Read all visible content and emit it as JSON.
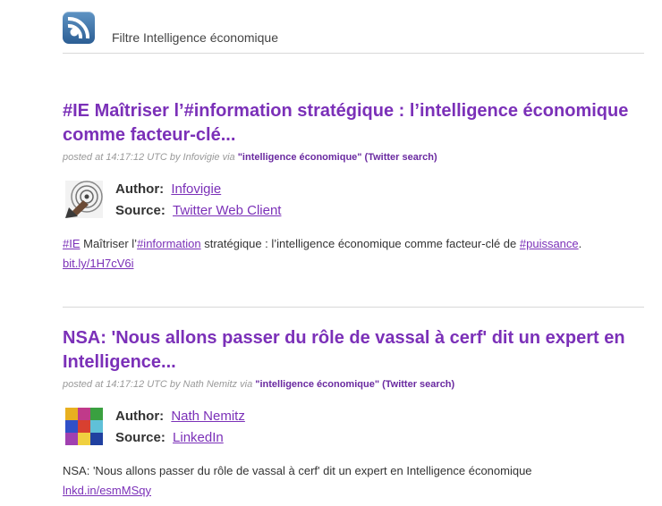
{
  "header": {
    "feed_icon": "rss-icon",
    "feed_title": "Filtre Intelligence économique"
  },
  "entries": [
    {
      "title": "#IE Maîtriser l’#information stratégique : l’intelligence économique comme facteur-clé...",
      "meta": {
        "posted_at": "posted at 14:17:12 UTC by",
        "author": "Infovigie",
        "via_label": "via",
        "via_link": "\"intelligence économique\" (Twitter search)"
      },
      "author_label": "Author:",
      "author_name": "Infovigie",
      "source_label": "Source:",
      "source_name": "Twitter Web Client",
      "avatar_icon": "target-avatar",
      "content": {
        "hashtag1": "#IE",
        "text1": " Maîtriser l’",
        "hashtag2": "#information",
        "text2": " stratégique : l’intelligence économique comme facteur-clé de ",
        "hashtag3": "#puissance",
        "text3": ".",
        "link": "bit.ly/1H7cV6i"
      }
    },
    {
      "title": "NSA: 'Nous allons passer du rôle de vassal à cerf' dit un expert en Intelligence...",
      "meta": {
        "posted_at": "posted at 14:17:12 UTC by",
        "author": "Nath Nemitz",
        "via_label": "via",
        "via_link": "\"intelligence économique\" (Twitter search)"
      },
      "author_label": "Author:",
      "author_name": "Nath Nemitz",
      "source_label": "Source:",
      "source_name": "LinkedIn",
      "avatar_icon": "pop-art-mosaic-avatar",
      "content": {
        "text1": "NSA: 'Nous allons passer du rôle de vassal à cerf' dit un expert en Intelligence économique",
        "link": "lnkd.in/esmMSqy"
      }
    }
  ],
  "colors": {
    "link_purple": "#7b30b8",
    "meta_gray": "#999999",
    "divider": "#d8d8d8",
    "rss_blue": "#3a6fa6"
  }
}
